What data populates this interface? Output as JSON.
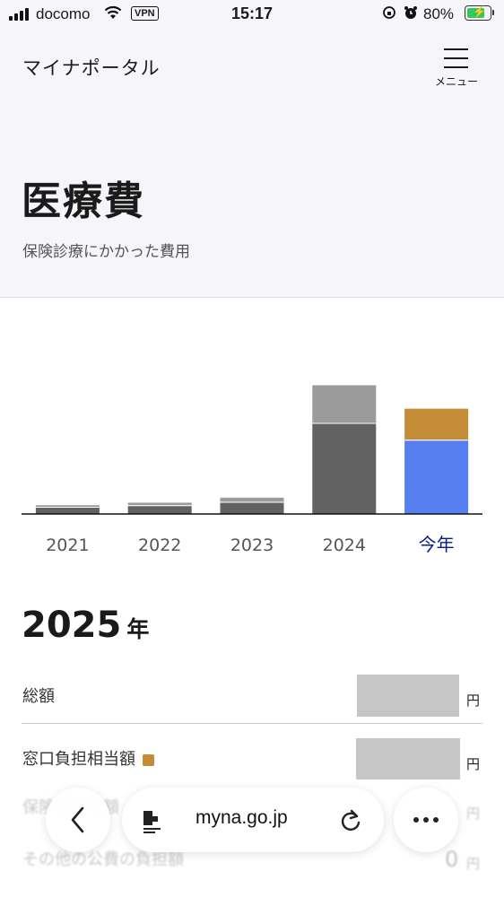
{
  "status_bar": {
    "carrier": "docomo",
    "vpn": "VPN",
    "time": "15:17",
    "battery_percent": "80%",
    "battery_level": 0.8
  },
  "header": {
    "site_title": "マイナポータル",
    "menu_label": "メニュー"
  },
  "page": {
    "title": "医療費",
    "subtitle": "保険診療にかかった費用"
  },
  "colors": {
    "accent_blue": "#567ff0",
    "copay_gold": "#c58c38",
    "bar_dark": "#626262",
    "bar_light": "#9b9b9b",
    "current_label": "#001f8a"
  },
  "chart_data": {
    "type": "bar",
    "stacked": true,
    "categories": [
      "2021",
      "2022",
      "2023",
      "2024",
      "今年"
    ],
    "highlighted_category": "今年",
    "series": [
      {
        "values": [
          4,
          5,
          7,
          54,
          44
        ]
      },
      {
        "values": [
          1.5,
          2,
          3,
          23,
          19
        ]
      }
    ],
    "ylim": [
      0,
      85
    ],
    "grid": false,
    "legend": "none"
  },
  "summary": {
    "year": "2025",
    "year_unit": "年",
    "rows": [
      {
        "label": "総額",
        "unit": "円"
      },
      {
        "label": "窓口負担相当額",
        "unit": "円",
        "swatch": "#c58c38"
      },
      {
        "label": "保険者負担額",
        "unit": "円"
      },
      {
        "label": "その他の公費の負担額",
        "value": "0",
        "unit": "円"
      }
    ]
  },
  "browser": {
    "url": "myna.go.jp"
  }
}
